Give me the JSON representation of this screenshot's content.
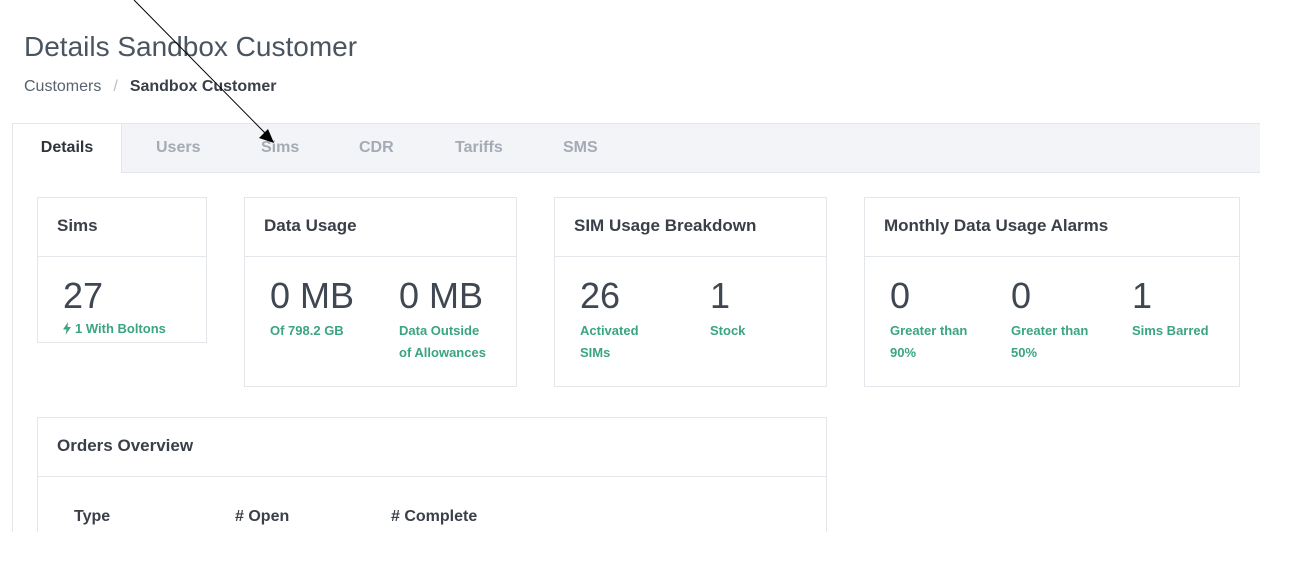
{
  "header": {
    "title": "Details Sandbox Customer",
    "breadcrumb": {
      "parent": "Customers",
      "separator": "/",
      "current": "Sandbox Customer"
    }
  },
  "tabs": [
    {
      "label": "Details",
      "active": true
    },
    {
      "label": "Users",
      "active": false
    },
    {
      "label": "Sims",
      "active": false
    },
    {
      "label": "CDR",
      "active": false
    },
    {
      "label": "Tariffs",
      "active": false
    },
    {
      "label": "SMS",
      "active": false
    }
  ],
  "cards": {
    "sims": {
      "title": "Sims",
      "value": "27",
      "label": "1 With Boltons",
      "icon": "bolt-icon"
    },
    "data_usage": {
      "title": "Data Usage",
      "stats": [
        {
          "value": "0 MB",
          "label_line1": "Of 798.2 GB",
          "label_line2": ""
        },
        {
          "value": "0 MB",
          "label_line1": "Data Outside",
          "label_line2": "of Allowances"
        }
      ]
    },
    "sim_usage": {
      "title": "SIM Usage Breakdown",
      "stats": [
        {
          "value": "26",
          "label_line1": "Activated",
          "label_line2": "SIMs"
        },
        {
          "value": "1",
          "label_line1": "Stock",
          "label_line2": ""
        }
      ]
    },
    "alarms": {
      "title": "Monthly Data Usage Alarms",
      "stats": [
        {
          "value": "0",
          "label_line1": "Greater than",
          "label_line2": "90%"
        },
        {
          "value": "0",
          "label_line1": "Greater than",
          "label_line2": "50%"
        },
        {
          "value": "1",
          "label_line1": "Sims Barred",
          "label_line2": ""
        }
      ]
    },
    "orders": {
      "title": "Orders Overview",
      "columns": [
        "Type",
        "# Open",
        "# Complete"
      ]
    }
  },
  "colors": {
    "accent": "#3aa57f",
    "tab_bar_bg": "#f2f4f7",
    "inactive_tab": "#a5abb5"
  }
}
